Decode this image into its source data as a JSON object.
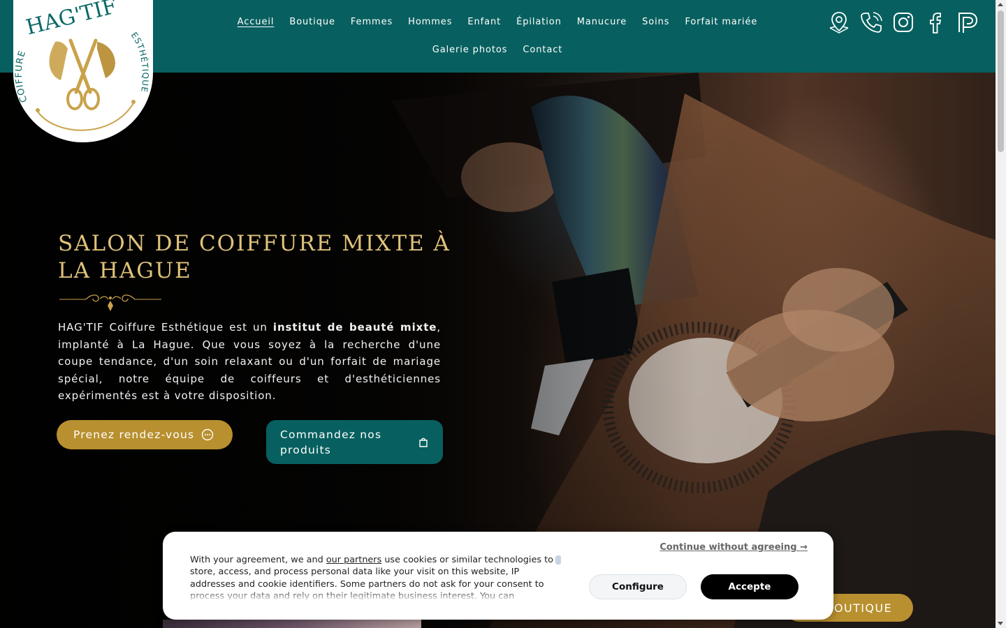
{
  "brand": {
    "name": "HAG'TIF",
    "left_text": "COIFFURE",
    "right_text": "ESTHÉTIQUE",
    "accent": "#b9902f",
    "primary": "#07605f"
  },
  "nav": {
    "items": [
      {
        "label": "Accueil"
      },
      {
        "label": "Boutique"
      },
      {
        "label": "Femmes"
      },
      {
        "label": "Hommes"
      },
      {
        "label": "Enfant"
      },
      {
        "label": "Épilation"
      },
      {
        "label": "Manucure"
      },
      {
        "label": "Soins"
      },
      {
        "label": "Forfait mariée"
      },
      {
        "label": "Galerie photos"
      },
      {
        "label": "Contact"
      }
    ],
    "active": "Accueil",
    "icons": [
      "map-pin-icon",
      "phone-icon",
      "instagram-icon",
      "facebook-icon",
      "pinterest-icon"
    ]
  },
  "hero": {
    "title": "SALON DE COIFFURE MIXTE À LA HAGUE",
    "text_intro": "HAG'TIF Coiffure Esthétique est un ",
    "text_bold": "institut de beauté mixte",
    "text_rest": ", implanté à La Hague. Que vous soyez à la recherche d'une coupe tendance, d'un soin relaxant ou d'un forfait de mariage spécial, notre équipe de coiffeurs et d'esthéticiennes expérimentés est à votre disposition.",
    "btn_appointment": "Prenez rendez-vous",
    "btn_order": "Commandez nos produits",
    "btn_boutique": "BOUTIQUE"
  },
  "cookie": {
    "continue": "Continue without agreeing →",
    "text_before": "With your agreement, we and ",
    "partners_link": "our partners",
    "text_after": " use cookies or similar technologies to store, access, and process personal data like your visit on this website, IP addresses and cookie identifiers. Some partners do not ask for your consent to process your data and rely on their legitimate business interest. You can",
    "configure": "Configure",
    "accept": "Accepte"
  }
}
